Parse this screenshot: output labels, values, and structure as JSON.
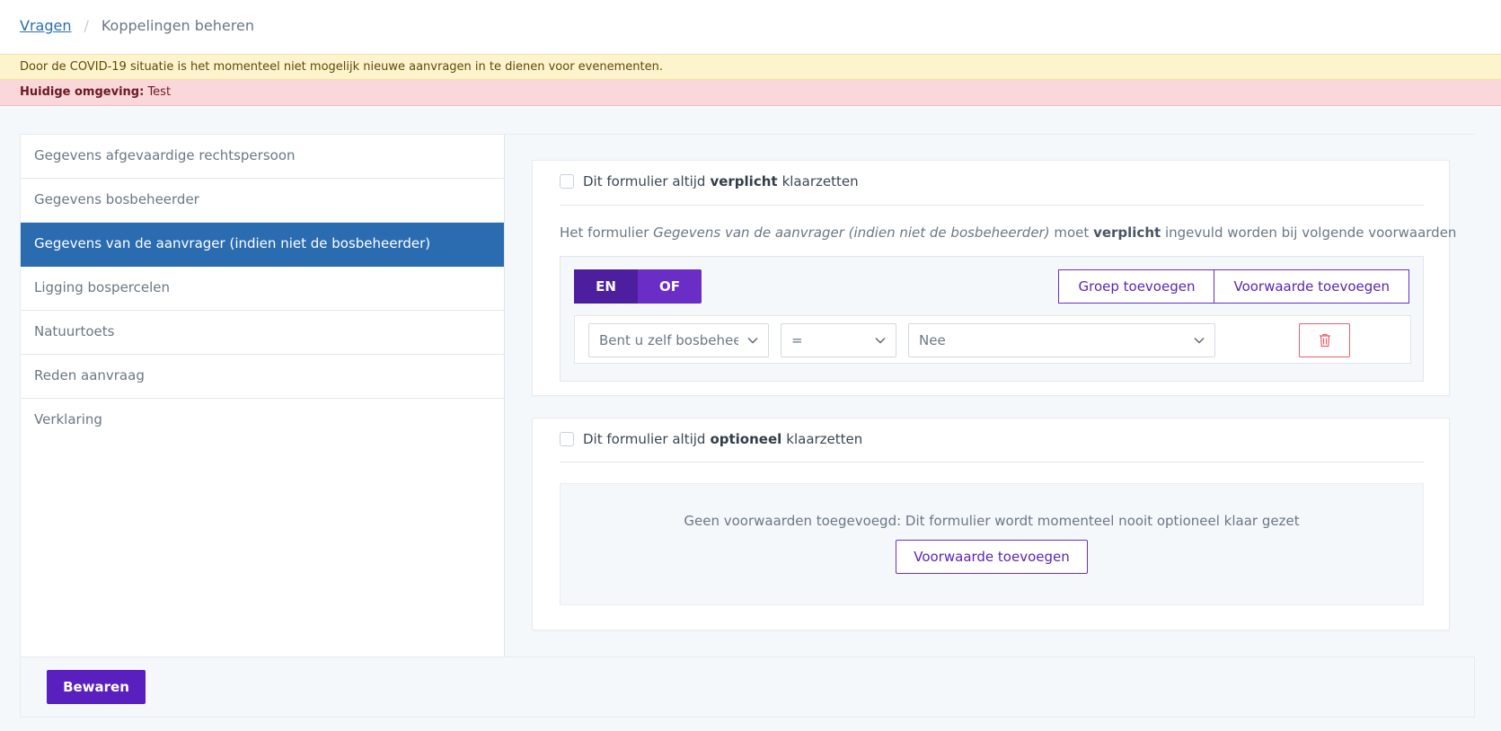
{
  "breadcrumb": {
    "link": "Vragen",
    "separator": "/",
    "current": "Koppelingen beheren"
  },
  "alerts": {
    "covid": "Door de COVID-19 situatie is het momenteel niet mogelijk nieuwe aanvragen in te dienen voor evenementen.",
    "env_label": "Huidige omgeving:",
    "env_value": "Test"
  },
  "sidebar": {
    "items": [
      {
        "label": "Gegevens afgevaardige rechtspersoon"
      },
      {
        "label": "Gegevens bosbeheerder"
      },
      {
        "label": "Gegevens van de aanvrager (indien niet de bosbeheerder)"
      },
      {
        "label": "Ligging bospercelen"
      },
      {
        "label": "Natuurtoets"
      },
      {
        "label": "Reden aanvraag"
      },
      {
        "label": "Verklaring"
      }
    ]
  },
  "mandatory": {
    "check_prefix": "Dit formulier altijd",
    "check_bold": "verplicht",
    "check_suffix": "klaarzetten",
    "cond_prefix": "Het formulier",
    "cond_form": "Gegevens van de aanvrager (indien niet de bosbeheerder)",
    "cond_mid": "moet",
    "cond_bold": "verplicht",
    "cond_suffix": "ingevuld worden bij volgende voorwaarden",
    "toggle_en": "EN",
    "toggle_of": "OF",
    "add_group": "Groep toevoegen",
    "add_condition": "Voorwaarde toevoegen",
    "condition": {
      "question": "Bent u zelf bosbeheerder?",
      "operator": "=",
      "value": "Nee"
    }
  },
  "optional": {
    "check_prefix": "Dit formulier altijd",
    "check_bold": "optioneel",
    "check_suffix": "klaarzetten",
    "empty_text": "Geen voorwaarden toegevoegd: Dit formulier wordt momenteel nooit optioneel klaar gezet",
    "add_condition": "Voorwaarde toevoegen"
  },
  "footer": {
    "save": "Bewaren"
  },
  "colors": {
    "primary": "#2b6cb0",
    "purple": "#6a2ec7",
    "purple_dark": "#4d1f9e",
    "danger": "#e4606d",
    "warning_bg": "#fdf3cc",
    "env_bg": "#f9d7da"
  }
}
